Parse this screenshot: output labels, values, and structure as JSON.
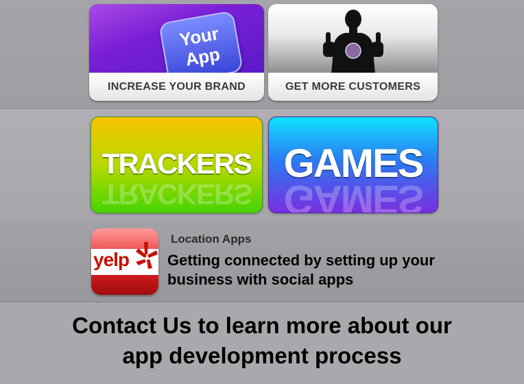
{
  "promos": [
    {
      "badge_line1": "Your",
      "badge_line2": "App",
      "caption": "INCREASE YOUR BRAND"
    },
    {
      "caption": "GET MORE CUSTOMERS"
    }
  ],
  "categories": {
    "trackers": "TRACKERS",
    "games": "GAMES"
  },
  "location": {
    "logo_text": "yelp",
    "title": "Location Apps",
    "description": "Getting connected by setting up your business with social apps"
  },
  "contact": {
    "text": "Contact Us to learn more about our app development process"
  },
  "colors": {
    "background": "#a9a8ad",
    "brand_purple": "#7a1fd6",
    "trackers_yellow": "#f7c400",
    "trackers_green": "#46d400",
    "games_cyan": "#0fe1ff",
    "games_purple": "#7a2ee0",
    "yelp_red": "#c41200"
  }
}
